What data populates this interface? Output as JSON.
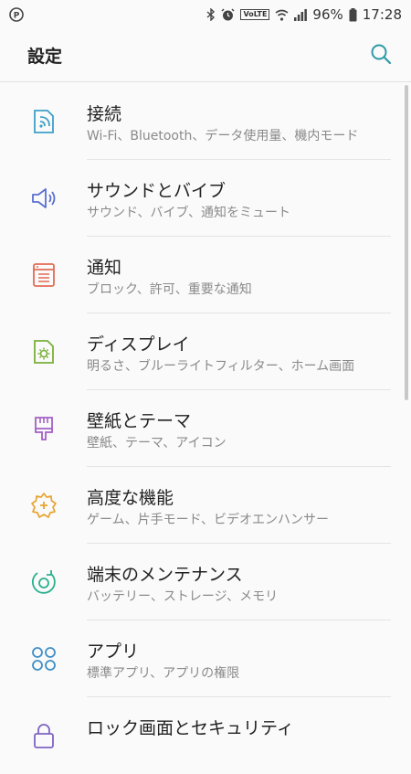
{
  "status_bar": {
    "battery": "96%",
    "time": "17:28",
    "volte": "VoLTE"
  },
  "header": {
    "title": "設定"
  },
  "settings": [
    {
      "label": "接続",
      "sub": "Wi-Fi、Bluetooth、データ使用量、機内モード",
      "icon": "connections-icon",
      "color": "#3fa0c8"
    },
    {
      "label": "サウンドとバイブ",
      "sub": "サウンド、バイブ、通知をミュート",
      "icon": "sound-icon",
      "color": "#5a6fd0"
    },
    {
      "label": "通知",
      "sub": "ブロック、許可、重要な通知",
      "icon": "notifications-icon",
      "color": "#e36b55"
    },
    {
      "label": "ディスプレイ",
      "sub": "明るさ、ブルーライトフィルター、ホーム画面",
      "icon": "display-icon",
      "color": "#7ab03a"
    },
    {
      "label": "壁紙とテーマ",
      "sub": "壁紙、テーマ、アイコン",
      "icon": "wallpaper-icon",
      "color": "#a35fc7"
    },
    {
      "label": "高度な機能",
      "sub": "ゲーム、片手モード、ビデオエンハンサー",
      "icon": "advanced-features-icon",
      "color": "#e8a431"
    },
    {
      "label": "端末のメンテナンス",
      "sub": "バッテリー、ストレージ、メモリ",
      "icon": "device-maintenance-icon",
      "color": "#2ab08e"
    },
    {
      "label": "アプリ",
      "sub": "標準アプリ、アプリの権限",
      "icon": "apps-icon",
      "color": "#3f8fc6"
    },
    {
      "label": "ロック画面とセキュリティ",
      "sub": "",
      "icon": "lock-icon",
      "color": "#7f63c4"
    }
  ]
}
